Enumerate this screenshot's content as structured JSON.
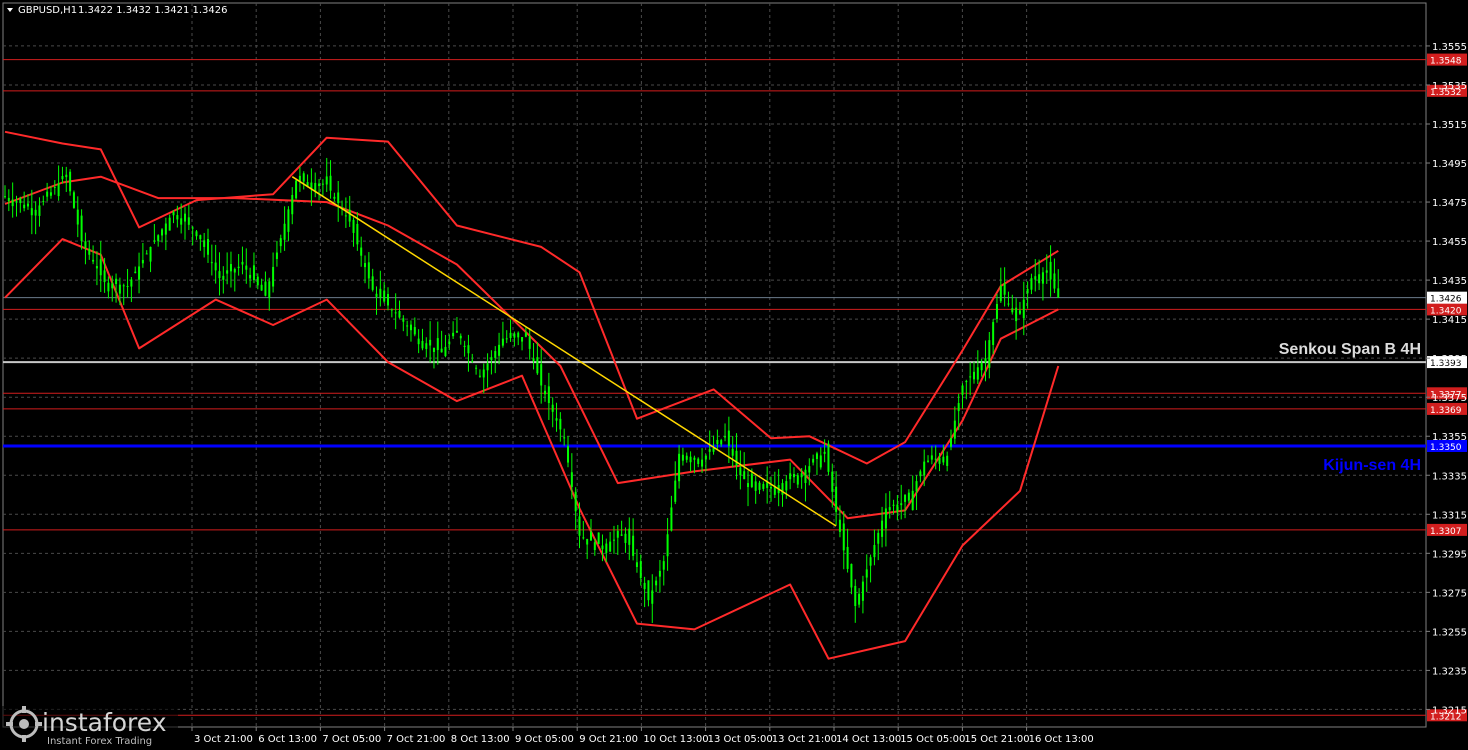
{
  "header": {
    "symbol": "GBPUSD,H1",
    "ohlc": "1.3422 1.3432 1.3421 1.3426"
  },
  "watermark": {
    "brand": "instaforex",
    "tagline": "Instant Forex Trading"
  },
  "colors": {
    "background": "#000000",
    "grid": "#4a4a4a",
    "candle": "#00ff00",
    "ichimoku": "#ff2a2a",
    "trendline": "#ffd700",
    "kijun": "#0000ff",
    "senkou": "#c8c8c8",
    "level": "#d21e1e"
  },
  "chart_data": {
    "type": "line",
    "title": "GBPUSD,H1",
    "ylim": [
      1.3206,
      1.3577
    ],
    "price_ticks": [
      "1.3555",
      "1.3535",
      "1.3515",
      "1.3495",
      "1.3475",
      "1.3455",
      "1.3435",
      "1.3415",
      "1.3395",
      "1.3375",
      "1.3355",
      "1.3335",
      "1.3315",
      "1.3295",
      "1.3275",
      "1.3255",
      "1.3235",
      "1.3215"
    ],
    "time_ticks": [
      "3 Oct 21:00",
      "6 Oct 13:00",
      "7 Oct 05:00",
      "7 Oct 21:00",
      "8 Oct 13:00",
      "9 Oct 05:00",
      "9 Oct 21:00",
      "10 Oct 13:00",
      "13 Oct 05:00",
      "13 Oct 21:00",
      "14 Oct 13:00",
      "15 Oct 05:00",
      "15 Oct 21:00",
      "16 Oct 13:00"
    ],
    "horizontal_levels": [
      {
        "value": 1.3548,
        "label": "1.3548",
        "kind": "support-resistance"
      },
      {
        "value": 1.3532,
        "label": "1.3532",
        "kind": "support-resistance"
      },
      {
        "value": 1.342,
        "label": "1.3420",
        "kind": "support-resistance"
      },
      {
        "value": 1.3377,
        "label": "1.3377",
        "kind": "support-resistance"
      },
      {
        "value": 1.3369,
        "label": "1.3369",
        "kind": "support-resistance"
      },
      {
        "value": 1.3307,
        "label": "1.3307",
        "kind": "support-resistance"
      },
      {
        "value": 1.3212,
        "label": "1.3212",
        "kind": "support-resistance"
      },
      {
        "value": 1.3393,
        "label": "1.3393",
        "kind": "senkou",
        "name": "Senkou Span B 4H"
      },
      {
        "value": 1.335,
        "label": "1.3350",
        "kind": "kijun",
        "name": "Kijun-sen 4H"
      }
    ],
    "current_price": {
      "value": 1.3426,
      "label": "1.3426"
    },
    "trendline": {
      "from": [
        0,
        1.3488
      ],
      "to": [
        217,
        1.3309
      ]
    },
    "ichimoku_cloud": {
      "upper": [
        [
          0,
          1.3511
        ],
        [
          15,
          1.3505
        ],
        [
          25,
          1.3502
        ],
        [
          35,
          1.3462
        ],
        [
          50,
          1.3476
        ],
        [
          70,
          1.3479
        ],
        [
          84,
          1.3508
        ],
        [
          100,
          1.3506
        ],
        [
          118,
          1.3463
        ],
        [
          140,
          1.3452
        ],
        [
          150,
          1.3439
        ],
        [
          165,
          1.3364
        ],
        [
          185,
          1.3379
        ],
        [
          200,
          1.3354
        ],
        [
          210,
          1.3355
        ],
        [
          225,
          1.3341
        ],
        [
          235,
          1.3352
        ],
        [
          250,
          1.3399
        ],
        [
          260,
          1.3432
        ],
        [
          275,
          1.345
        ]
      ],
      "middle": [
        [
          0,
          1.3474
        ],
        [
          15,
          1.3485
        ],
        [
          25,
          1.3488
        ],
        [
          40,
          1.3477
        ],
        [
          60,
          1.3477
        ],
        [
          84,
          1.3475
        ],
        [
          100,
          1.3463
        ],
        [
          118,
          1.3443
        ],
        [
          145,
          1.3391
        ],
        [
          160,
          1.3331
        ],
        [
          180,
          1.3337
        ],
        [
          205,
          1.3343
        ],
        [
          220,
          1.3313
        ],
        [
          235,
          1.3317
        ],
        [
          250,
          1.3363
        ],
        [
          260,
          1.3405
        ],
        [
          275,
          1.342
        ]
      ],
      "lower": [
        [
          0,
          1.3426
        ],
        [
          15,
          1.3456
        ],
        [
          25,
          1.3448
        ],
        [
          35,
          1.34
        ],
        [
          55,
          1.3425
        ],
        [
          70,
          1.3412
        ],
        [
          84,
          1.3425
        ],
        [
          100,
          1.3393
        ],
        [
          118,
          1.3373
        ],
        [
          135,
          1.3386
        ],
        [
          150,
          1.3318
        ],
        [
          165,
          1.3259
        ],
        [
          180,
          1.3256
        ],
        [
          205,
          1.3279
        ],
        [
          215,
          1.3241
        ],
        [
          235,
          1.325
        ],
        [
          250,
          1.3299
        ],
        [
          265,
          1.3327
        ],
        [
          275,
          1.3391
        ]
      ]
    },
    "price_path": [
      [
        0,
        1.3478
      ],
      [
        8,
        1.3471
      ],
      [
        16,
        1.3489
      ],
      [
        20,
        1.3455
      ],
      [
        26,
        1.3434
      ],
      [
        32,
        1.3432
      ],
      [
        38,
        1.3452
      ],
      [
        44,
        1.347
      ],
      [
        50,
        1.346
      ],
      [
        56,
        1.3436
      ],
      [
        62,
        1.3443
      ],
      [
        68,
        1.3427
      ],
      [
        76,
        1.3486
      ],
      [
        84,
        1.3484
      ],
      [
        90,
        1.3465
      ],
      [
        96,
        1.343
      ],
      [
        102,
        1.3418
      ],
      [
        108,
        1.3405
      ],
      [
        114,
        1.3398
      ],
      [
        118,
        1.3409
      ],
      [
        124,
        1.3386
      ],
      [
        130,
        1.3405
      ],
      [
        136,
        1.3406
      ],
      [
        140,
        1.3381
      ],
      [
        146,
        1.3354
      ],
      [
        150,
        1.3304
      ],
      [
        156,
        1.3299
      ],
      [
        162,
        1.3305
      ],
      [
        168,
        1.3271
      ],
      [
        172,
        1.3291
      ],
      [
        176,
        1.3346
      ],
      [
        182,
        1.3343
      ],
      [
        188,
        1.3355
      ],
      [
        192,
        1.3335
      ],
      [
        196,
        1.3327
      ],
      [
        202,
        1.333
      ],
      [
        208,
        1.3336
      ],
      [
        214,
        1.3347
      ],
      [
        218,
        1.3306
      ],
      [
        222,
        1.3268
      ],
      [
        226,
        1.3293
      ],
      [
        230,
        1.3318
      ],
      [
        236,
        1.3322
      ],
      [
        240,
        1.3342
      ],
      [
        246,
        1.3345
      ],
      [
        250,
        1.3381
      ],
      [
        256,
        1.3395
      ],
      [
        260,
        1.3432
      ],
      [
        264,
        1.3414
      ],
      [
        268,
        1.3436
      ],
      [
        272,
        1.344
      ],
      [
        275,
        1.3426
      ]
    ]
  }
}
